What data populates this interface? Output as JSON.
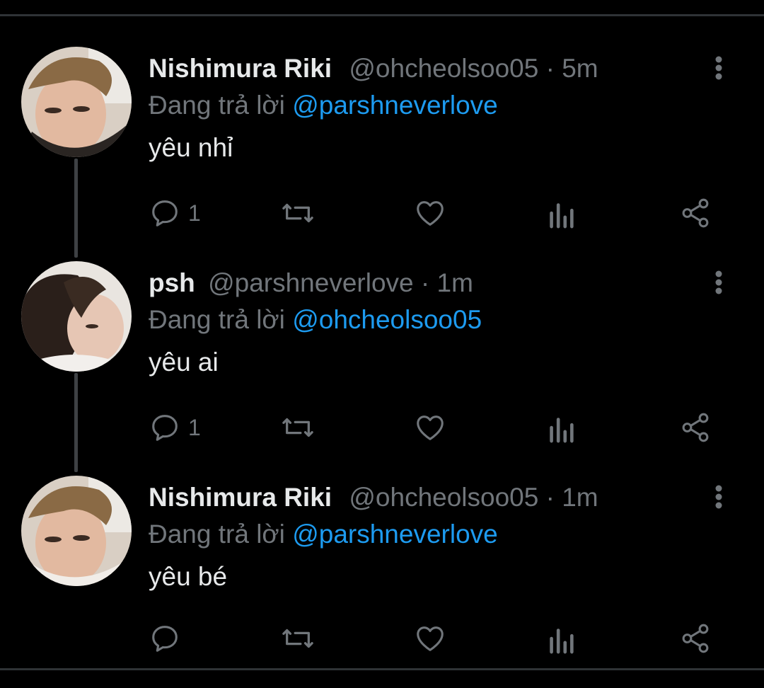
{
  "tweets": [
    {
      "name": "Nishimura Riki",
      "handle": "@ohcheolsoo05",
      "sep": "·",
      "time": "5m",
      "reply_prefix": "Đang trả lời",
      "reply_to": "@parshneverlove",
      "text": "yêu nhỉ",
      "reply_count": "1",
      "avatar": "avatar-riki"
    },
    {
      "name": "psh",
      "handle": "@parshneverlove",
      "sep": "·",
      "time": "1m",
      "reply_prefix": "Đang trả lời",
      "reply_to": "@ohcheolsoo05",
      "text": "yêu ai",
      "reply_count": "1",
      "avatar": "avatar-psh"
    },
    {
      "name": "Nishimura Riki",
      "handle": "@ohcheolsoo05",
      "sep": "·",
      "time": "1m",
      "reply_prefix": "Đang trả lời",
      "reply_to": "@parshneverlove",
      "text": "yêu bé",
      "reply_count": "",
      "avatar": "avatar-riki"
    }
  ],
  "icons": [
    "reply-icon",
    "retweet-icon",
    "like-icon",
    "views-icon",
    "share-icon",
    "more-icon"
  ],
  "colors": {
    "background": "#000000",
    "text": "#e7e9ea",
    "muted": "#71767b",
    "link": "#1d9bf0",
    "thread_line": "#3e4144"
  }
}
